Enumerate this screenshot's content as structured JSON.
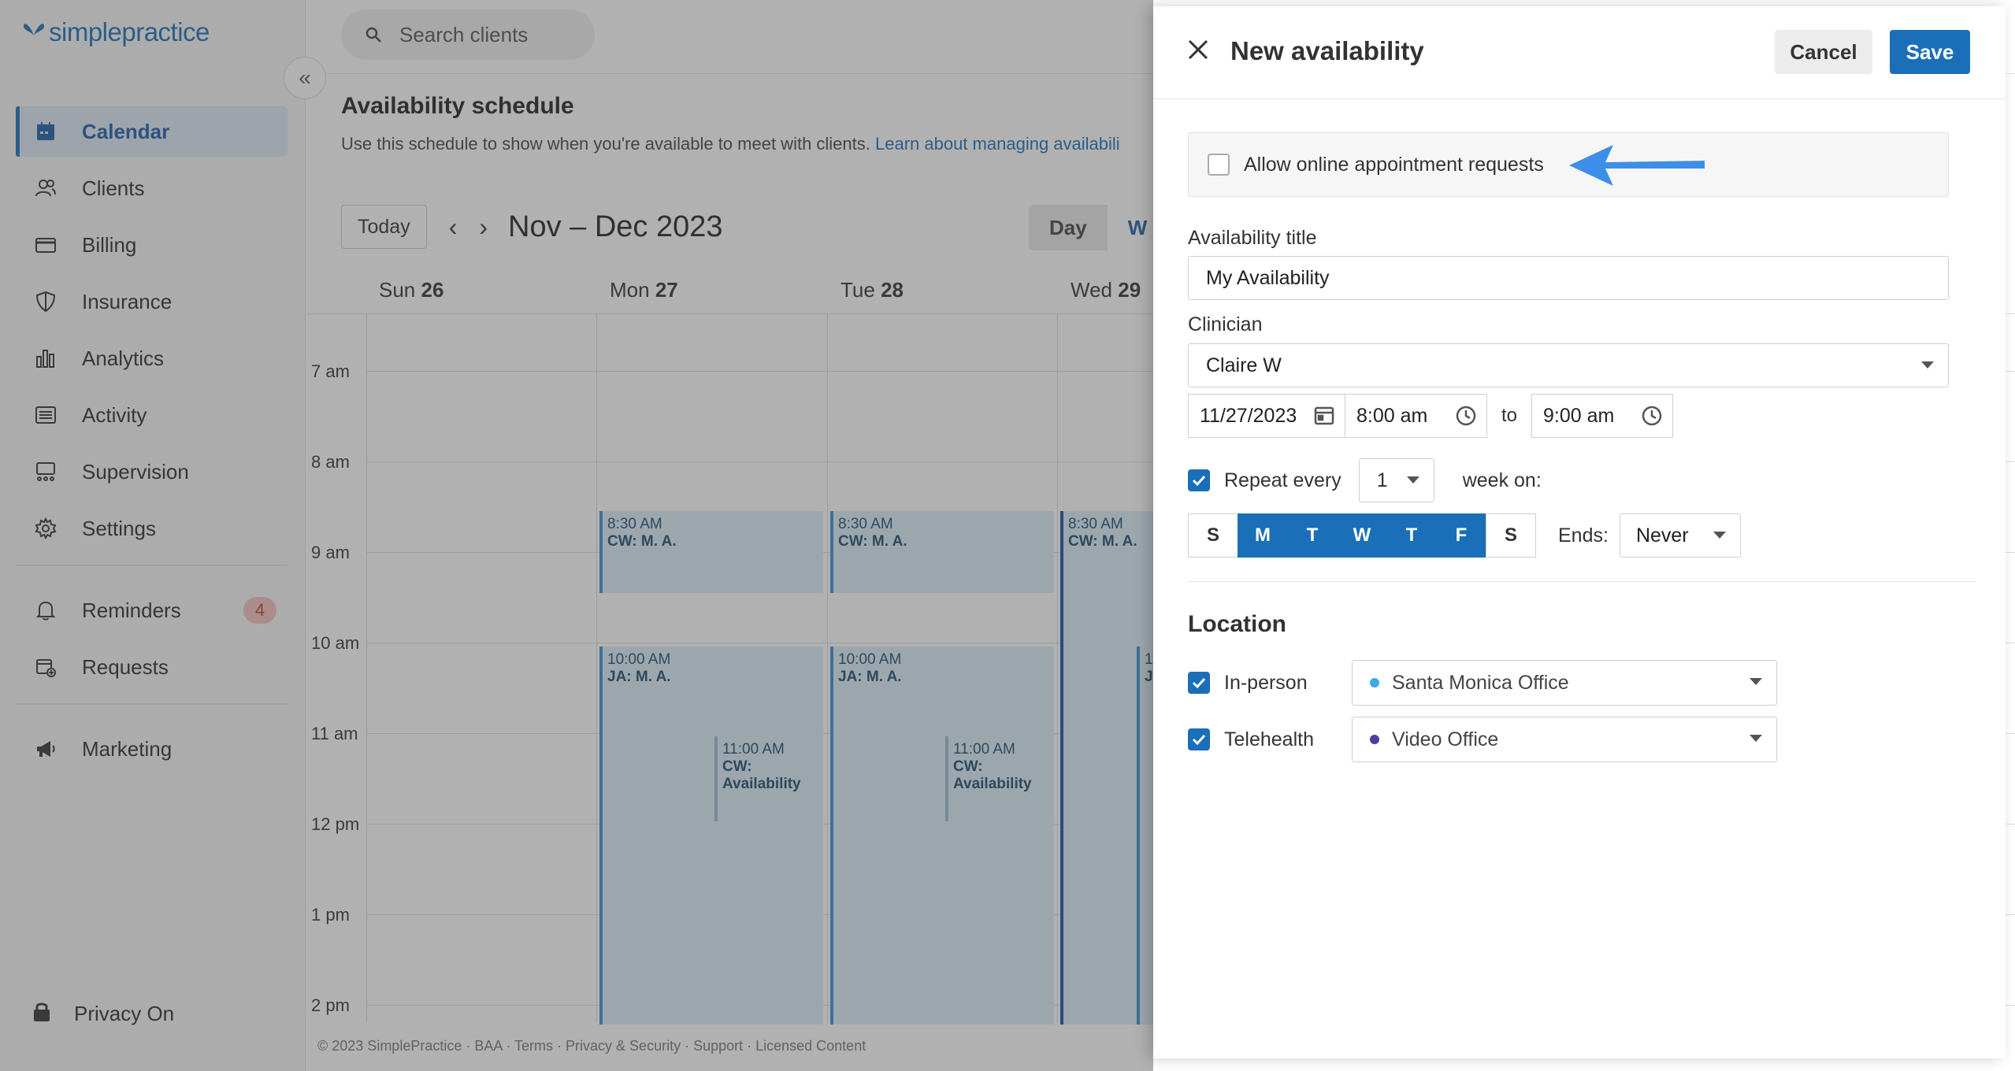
{
  "sidebar": {
    "logo_text": "simplepractice",
    "items": [
      {
        "label": "Calendar",
        "icon": "calendar-icon",
        "active": true
      },
      {
        "label": "Clients",
        "icon": "users-icon"
      },
      {
        "label": "Billing",
        "icon": "credit-card-icon"
      },
      {
        "label": "Insurance",
        "icon": "shield-icon"
      },
      {
        "label": "Analytics",
        "icon": "bar-chart-icon"
      },
      {
        "label": "Activity",
        "icon": "list-icon"
      },
      {
        "label": "Supervision",
        "icon": "supervision-icon"
      },
      {
        "label": "Settings",
        "icon": "gear-icon"
      }
    ],
    "secondary": [
      {
        "label": "Reminders",
        "icon": "bell-icon",
        "badge": "4"
      },
      {
        "label": "Requests",
        "icon": "calendar-plus-icon"
      }
    ],
    "marketing": {
      "label": "Marketing",
      "icon": "megaphone-icon"
    },
    "privacy": {
      "label": "Privacy On",
      "icon": "lock-icon"
    }
  },
  "topbar": {
    "search_placeholder": "Search clients"
  },
  "schedule": {
    "title": "Availability schedule",
    "subtitle": "Use this schedule to show when you're available to meet with clients.",
    "learn_link": "Learn about managing availabili",
    "today_label": "Today",
    "range": "Nov – Dec 2023",
    "view_day": "Day",
    "view_week": "W",
    "days": [
      {
        "name": "Sun",
        "num": "26"
      },
      {
        "name": "Mon",
        "num": "27"
      },
      {
        "name": "Tue",
        "num": "28"
      },
      {
        "name": "Wed",
        "num": "29"
      }
    ],
    "hours": [
      "7 am",
      "8 am",
      "9 am",
      "10 am",
      "11 am",
      "12 pm",
      "1 pm",
      "2 pm"
    ],
    "events": {
      "mon_a_time": "8:30 AM",
      "mon_a_title": "CW: M. A.",
      "mon_b_time": "10:00 AM",
      "mon_b_title": "JA: M. A.",
      "mon_c_time": "11:00 AM",
      "mon_c_title": "CW: Availability",
      "tue_a_time": "8:30 AM",
      "tue_a_title": "CW: M. A.",
      "tue_b_time": "10:00 AM",
      "tue_b_title": "JA: M. A.",
      "tue_c_time": "11:00 AM",
      "tue_c_title": "CW: Availability",
      "wed_a_time": "8:30 AM",
      "wed_a_title": "CW: M. A.",
      "wed_b_time": "1",
      "wed_b_title": "J"
    },
    "footer": "© 2023 SimplePractice · BAA · Terms · Privacy & Security · Support · Licensed Content"
  },
  "panel": {
    "title": "New availability",
    "cancel": "Cancel",
    "save": "Save",
    "online_requests_label": "Allow online appointment requests",
    "online_requests_checked": false,
    "title_label": "Availability title",
    "title_value": "My Availability",
    "clinician_label": "Clinician",
    "clinician_value": "Claire W",
    "date": "11/27/2023",
    "start_time": "8:00 am",
    "to_label": "to",
    "end_time": "9:00 am",
    "repeat_label": "Repeat every",
    "repeat_value": "1",
    "week_on_label": "week on:",
    "weekdays": [
      {
        "label": "S",
        "on": false
      },
      {
        "label": "M",
        "on": true
      },
      {
        "label": "T",
        "on": true
      },
      {
        "label": "W",
        "on": true
      },
      {
        "label": "T",
        "on": true
      },
      {
        "label": "F",
        "on": true
      },
      {
        "label": "S",
        "on": false
      }
    ],
    "ends_label": "Ends:",
    "ends_value": "Never",
    "location_title": "Location",
    "in_person_label": "In-person",
    "in_person_value": "Santa Monica Office",
    "telehealth_label": "Telehealth",
    "telehealth_value": "Video Office"
  },
  "colors": {
    "brand": "#1a6fb8",
    "in_person_dot": "#3fa9e0",
    "telehealth_dot": "#4b3fa0",
    "arrow": "#3d8ee8"
  }
}
